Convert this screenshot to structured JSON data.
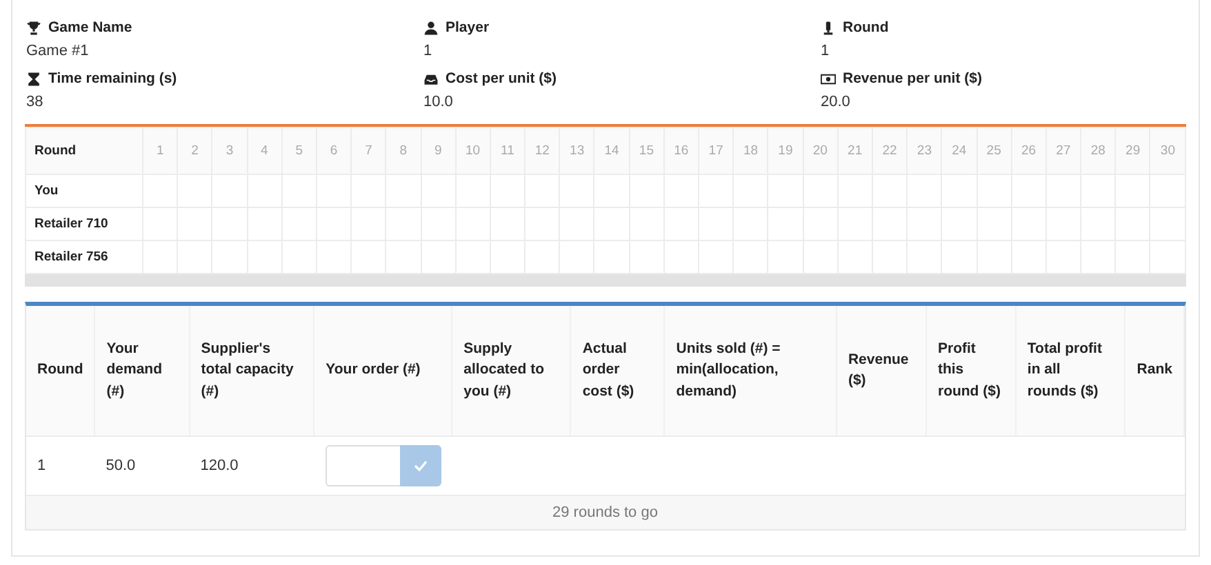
{
  "info": [
    {
      "label": "Game Name",
      "value": "Game #1"
    },
    {
      "label": "Player",
      "value": "1"
    },
    {
      "label": "Round",
      "value": "1"
    },
    {
      "label": "Time remaining (s)",
      "value": "38"
    },
    {
      "label": "Cost per unit ($)",
      "value": "10.0"
    },
    {
      "label": "Revenue per unit ($)",
      "value": "20.0"
    }
  ],
  "rounds_table": {
    "corner": "Round",
    "columns": [
      "1",
      "2",
      "3",
      "4",
      "5",
      "6",
      "7",
      "8",
      "9",
      "10",
      "11",
      "12",
      "13",
      "14",
      "15",
      "16",
      "17",
      "18",
      "19",
      "20",
      "21",
      "22",
      "23",
      "24",
      "25",
      "26",
      "27",
      "28",
      "29",
      "30"
    ],
    "rows": [
      "You",
      "Retailer 710",
      "Retailer 756"
    ]
  },
  "results_table": {
    "columns": [
      "Round",
      "Your demand (#)",
      "Supplier's total capacity (#)",
      "Your order (#)",
      "Supply allocated to you (#)",
      "Actual order cost ($)",
      "Units sold (#) = min(allocation, demand)",
      "Revenue ($)",
      "Profit this round ($)",
      "Total profit in all rounds ($)",
      "Rank"
    ],
    "row": {
      "round": "1",
      "demand": "50.0",
      "capacity": "120.0",
      "submit_disabled": true
    },
    "footer": "29 rounds to go"
  }
}
